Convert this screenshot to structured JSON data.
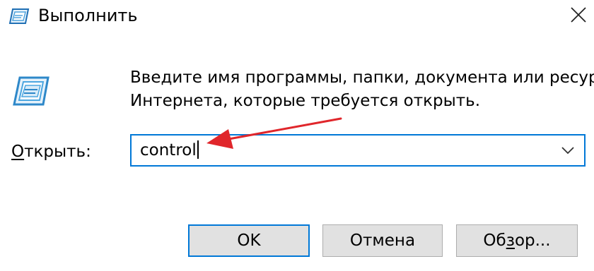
{
  "window": {
    "title": "Выполнить",
    "icon": "run-dialog-icon",
    "close_icon": "close-icon"
  },
  "description": {
    "line1": "Введите имя программы, папки, документа или ресурса",
    "line2": "Интернета, которые требуется открыть."
  },
  "open_field": {
    "label_mnemonic": "О",
    "label_rest": "ткрыть:",
    "value": "control",
    "dropdown_icon": "chevron-down-icon"
  },
  "buttons": {
    "ok": "OK",
    "cancel": "Отмена",
    "browse_before": "Об",
    "browse_mnemonic": "з",
    "browse_after": "ор..."
  },
  "colors": {
    "accent": "#0078d7",
    "annotation_arrow": "#e0262b",
    "button_face": "#e1e1e1",
    "icon_blue": "#2e88c9"
  }
}
